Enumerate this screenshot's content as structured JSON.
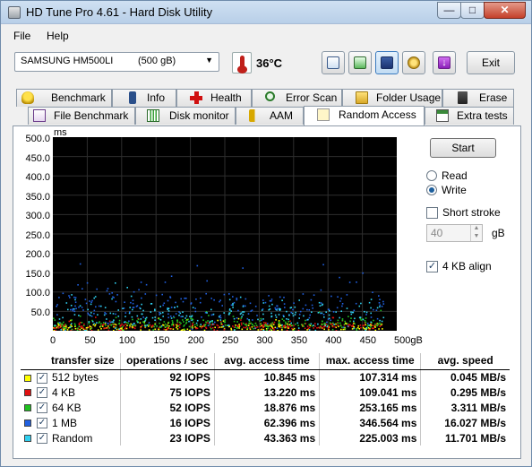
{
  "window": {
    "title": "HD Tune Pro 4.61 - Hard Disk Utility"
  },
  "menu": [
    "File",
    "Help"
  ],
  "toolbar": {
    "drive_name": "SAMSUNG HM500LI",
    "drive_capacity": "(500 gB)",
    "temperature": "36°C",
    "exit_label": "Exit"
  },
  "tabs_row1": [
    "Benchmark",
    "Info",
    "Health",
    "Error Scan",
    "Folder Usage",
    "Erase"
  ],
  "tabs_row2": [
    "File Benchmark",
    "Disk monitor",
    "AAM",
    "Random Access",
    "Extra tests"
  ],
  "active_tab": "Random Access",
  "graph": {
    "unit": "ms",
    "y_ticks": [
      "500.0",
      "450.0",
      "400.0",
      "350.0",
      "300.0",
      "250.0",
      "200.0",
      "150.0",
      "100.0",
      "50.0"
    ],
    "x_ticks": [
      "0",
      "50",
      "100",
      "150",
      "200",
      "250",
      "300",
      "350",
      "400",
      "450",
      "500gB"
    ]
  },
  "controls": {
    "start_label": "Start",
    "read_label": "Read",
    "write_label": "Write",
    "selected_mode": "Write",
    "short_stroke_label": "Short stroke",
    "short_stroke_checked": false,
    "short_stroke_value": "40",
    "short_stroke_unit": "gB",
    "align_label": "4 KB align",
    "align_checked": true
  },
  "results": {
    "headers": [
      "transfer size",
      "operations / sec",
      "avg. access time",
      "max. access time",
      "avg. speed"
    ],
    "rows": [
      {
        "size": "512 bytes",
        "color": "#ffff00",
        "ops": "92 IOPS",
        "avg": "10.845 ms",
        "max": "107.314 ms",
        "speed": "0.045 MB/s"
      },
      {
        "size": "4 KB",
        "color": "#e01010",
        "ops": "75 IOPS",
        "avg": "13.220 ms",
        "max": "109.041 ms",
        "speed": "0.295 MB/s"
      },
      {
        "size": "64 KB",
        "color": "#20c020",
        "ops": "52 IOPS",
        "avg": "18.876 ms",
        "max": "253.165 ms",
        "speed": "3.311 MB/s"
      },
      {
        "size": "1 MB",
        "color": "#2060e0",
        "ops": "16 IOPS",
        "avg": "62.396 ms",
        "max": "346.564 ms",
        "speed": "16.027 MB/s"
      },
      {
        "size": "Random",
        "color": "#30d0f0",
        "ops": "23 IOPS",
        "avg": "43.363 ms",
        "max": "225.003 ms",
        "speed": "11.701 MB/s"
      }
    ]
  }
}
